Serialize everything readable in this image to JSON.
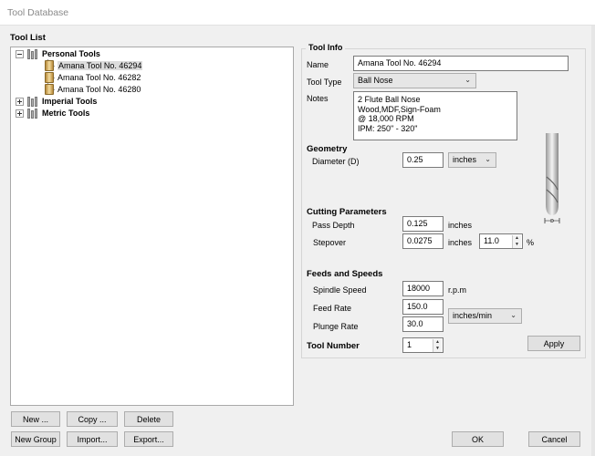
{
  "window": {
    "title": "Tool Database"
  },
  "tool_list": {
    "label": "Tool List",
    "groups": [
      {
        "name": "Personal Tools",
        "expanded": true,
        "children": [
          "Amana Tool No. 46294",
          "Amana Tool No. 46282",
          "Amana Tool No. 46280"
        ],
        "selected": "Amana Tool No. 46294"
      },
      {
        "name": "Imperial Tools",
        "expanded": false
      },
      {
        "name": "Metric Tools",
        "expanded": false
      }
    ]
  },
  "tool_info": {
    "title": "Tool Info",
    "name_label": "Name",
    "name_value": "Amana Tool No. 46294",
    "type_label": "Tool Type",
    "type_value": "Ball Nose",
    "notes_label": "Notes",
    "notes_value": "2 Flute Ball Nose\nWood,MDF,Sign-Foam\n@ 18,000 RPM\nIPM: 250\" - 320\""
  },
  "geometry": {
    "title": "Geometry",
    "diameter_label": "Diameter (D)",
    "diameter_value": "0.25",
    "diameter_unit": "inches"
  },
  "cutting": {
    "title": "Cutting Parameters",
    "pass_depth_label": "Pass Depth",
    "pass_depth_value": "0.125",
    "pass_depth_unit": "inches",
    "stepover_label": "Stepover",
    "stepover_value": "0.0275",
    "stepover_unit": "inches",
    "stepover_percent": "11.0",
    "percent_sign": "%"
  },
  "feeds": {
    "title": "Feeds and Speeds",
    "spindle_label": "Spindle Speed",
    "spindle_value": "18000",
    "spindle_unit": "r.p.m",
    "feed_label": "Feed Rate",
    "feed_value": "150.0",
    "plunge_label": "Plunge Rate",
    "plunge_value": "30.0",
    "rate_unit": "inches/min"
  },
  "tool_number": {
    "label": "Tool Number",
    "value": "1"
  },
  "diagram": {
    "dimension_label": "D"
  },
  "buttons": {
    "apply": "Apply",
    "new": "New ...",
    "copy": "Copy ...",
    "delete": "Delete",
    "new_group": "New Group",
    "import": "Import...",
    "export": "Export...",
    "ok": "OK",
    "cancel": "Cancel"
  },
  "icons": [
    "expand-collapse-icon",
    "tool-folder-icon",
    "tool-bit-icon",
    "dropdown-arrow-icon",
    "spin-up-icon",
    "spin-down-icon"
  ]
}
